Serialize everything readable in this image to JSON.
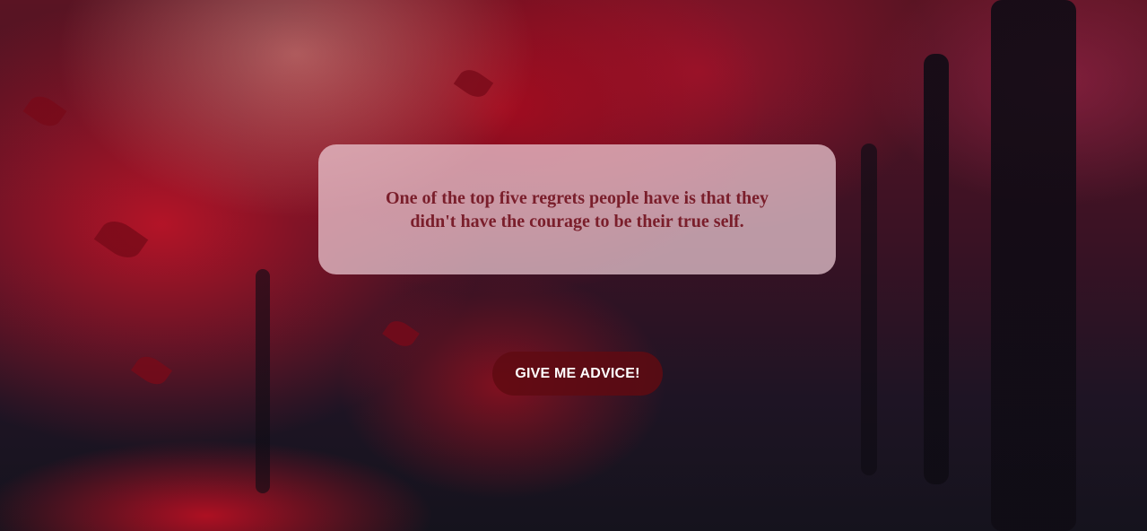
{
  "quote": {
    "text": "One of the top five regrets people have is that they didn't have the courage to be their true self."
  },
  "actions": {
    "advice_button_label": "GIVE ME ADVICE!"
  },
  "colors": {
    "quote_text": "#7a1e2b",
    "quote_box": "#eecdd7",
    "button_bg": "#5f0a12",
    "button_text": "#ffffff"
  }
}
